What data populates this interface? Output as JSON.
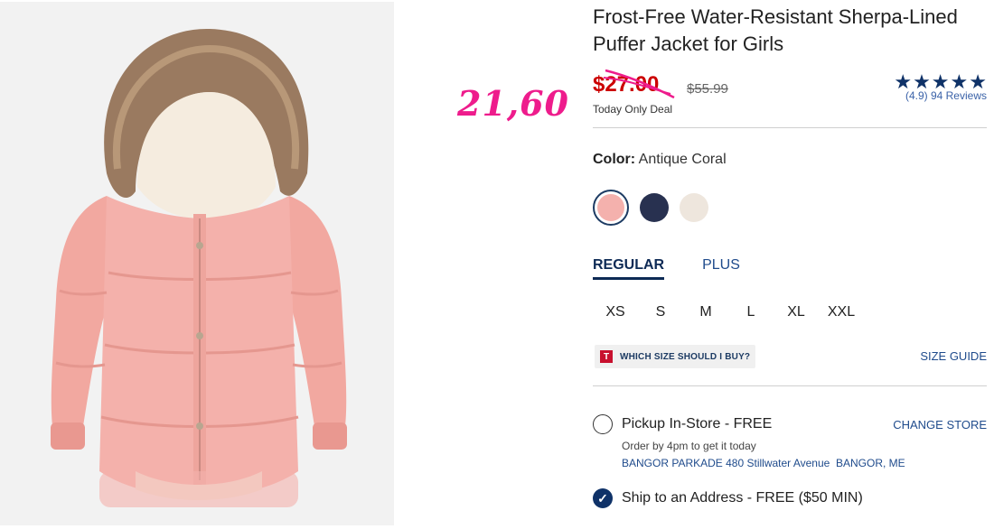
{
  "annotation": {
    "handwritten_price": "21,60"
  },
  "product": {
    "title": "Frost-Free Water-Resistant Sherpa-Lined Puffer Jacket for Girls",
    "sale_price": "$27.00",
    "original_price": "$55.99",
    "deal_label": "Today Only Deal",
    "rating": {
      "stars": 5,
      "review_text": "(4.9) 94 Reviews"
    }
  },
  "color": {
    "label": "Color:",
    "selected_name": "Antique Coral",
    "swatches": [
      {
        "name": "Antique Coral",
        "hex": "#f4b1ad",
        "selected": true
      },
      {
        "name": "Navy",
        "hex": "#283150",
        "selected": false
      },
      {
        "name": "Cream",
        "hex": "#eee6dd",
        "selected": false
      }
    ]
  },
  "fit_tabs": [
    {
      "label": "REGULAR",
      "active": true
    },
    {
      "label": "PLUS",
      "active": false
    }
  ],
  "sizes": [
    "XS",
    "S",
    "M",
    "L",
    "XL",
    "XXL"
  ],
  "size_help": {
    "badge": "T",
    "text": "WHICH SIZE SHOULD I BUY?"
  },
  "size_guide": "SIZE GUIDE",
  "fulfillment": {
    "pickup_label": "Pickup In-Store - FREE",
    "change_store": "CHANGE STORE",
    "pickup_note": "Order by 4pm to get it today",
    "store_address": "BANGOR PARKADE 480 Stillwater Avenue  BANGOR, ME",
    "ship_label": "Ship to an Address - FREE ($50 MIN)",
    "ship_check": "✓"
  },
  "colors": {
    "sale_red": "#cc0000",
    "navy": "#0f3268",
    "link_blue": "#1f4b8c",
    "annotation_pink": "#ee1c8c"
  }
}
